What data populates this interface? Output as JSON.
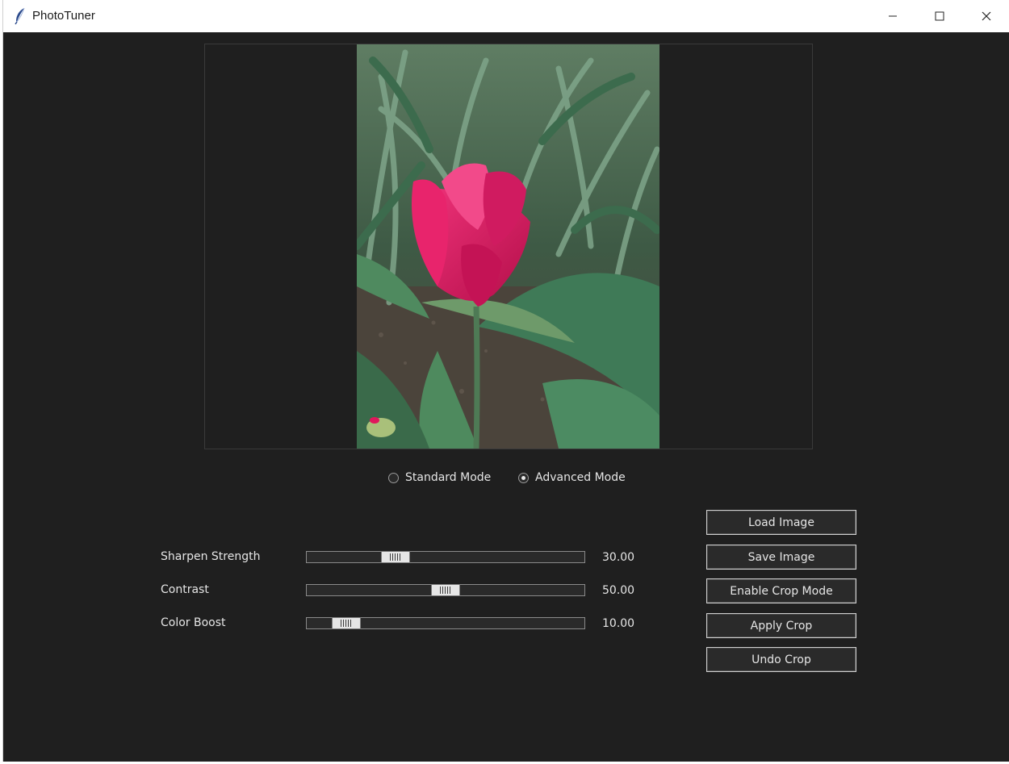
{
  "window": {
    "title": "PhotoTuner",
    "icon": "feather-icon",
    "controls": [
      "minimize-icon",
      "maximize-icon",
      "close-icon"
    ]
  },
  "modes": [
    {
      "label": "Standard Mode",
      "selected": false
    },
    {
      "label": "Advanced Mode",
      "selected": true
    }
  ],
  "sliders": [
    {
      "label": "Sharpen Strength",
      "value": "30.00",
      "level": 0.3
    },
    {
      "label": "Contrast",
      "value": "50.00",
      "level": 0.5
    },
    {
      "label": "Color Boost",
      "value": "10.00",
      "level": 0.1
    }
  ],
  "buttons": {
    "load": "Load Image",
    "save": "Save Image",
    "crop_mode": "Enable Crop Mode",
    "apply_crop": "Apply Crop",
    "undo_crop": "Undo Crop"
  },
  "colors": {
    "background": "#1f1f1f",
    "text": "#e6e6e6",
    "flower": "#e0185c"
  }
}
